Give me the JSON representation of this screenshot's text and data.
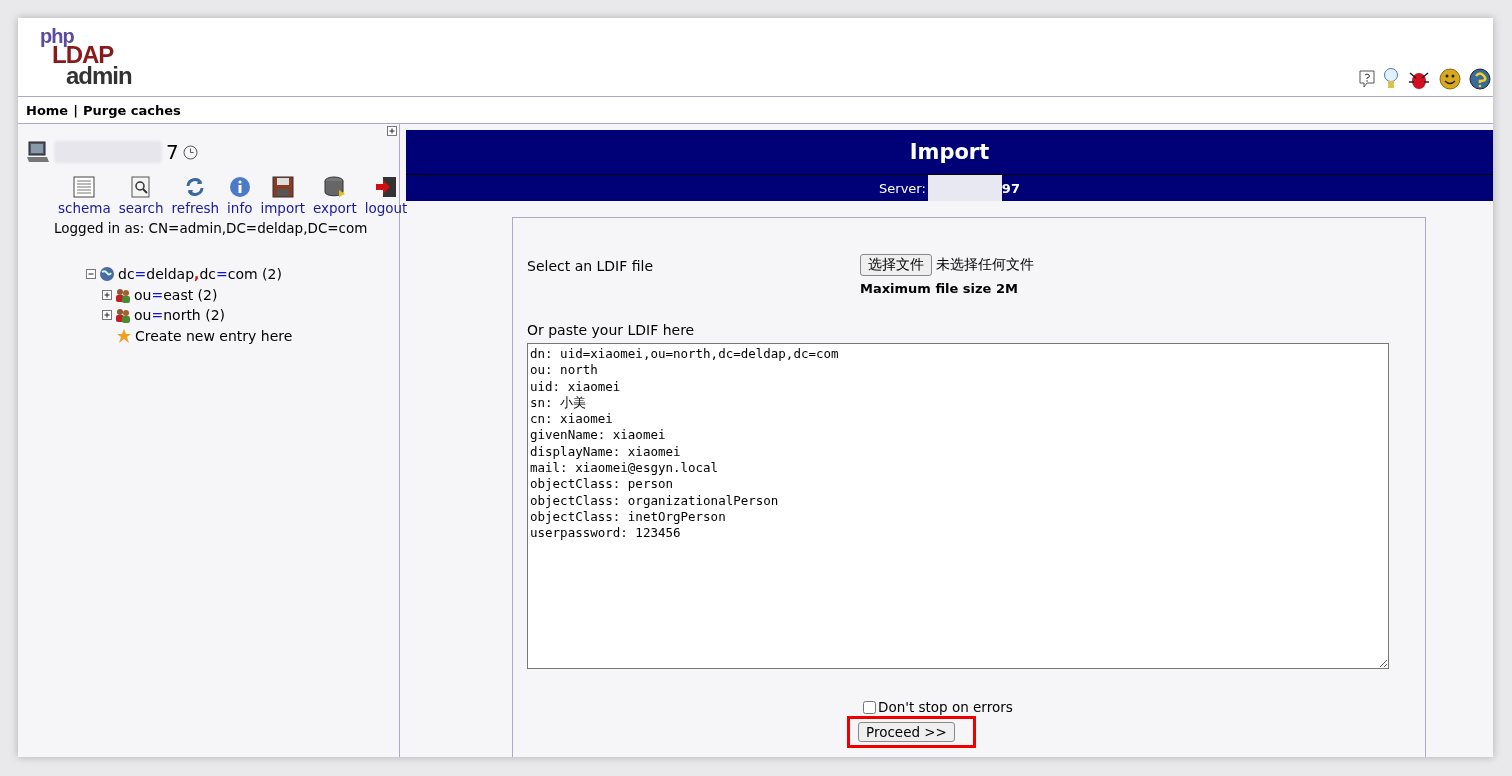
{
  "logo": {
    "parts": [
      "php",
      "LDAP",
      "admin"
    ]
  },
  "nav": {
    "links": [
      "Home",
      "Purge caches"
    ],
    "separator": "|"
  },
  "sidebar": {
    "server_name": "7",
    "toolbar": [
      {
        "label": "schema"
      },
      {
        "label": "search"
      },
      {
        "label": "refresh"
      },
      {
        "label": "info"
      },
      {
        "label": "import"
      },
      {
        "label": "export"
      },
      {
        "label": "logout"
      }
    ],
    "logged_in": "Logged in as: CN=admin,DC=deldap,DC=com",
    "tree": [
      {
        "kind": "base",
        "label": "dc=deldap,dc=com (2)",
        "expanded": true,
        "children": [
          {
            "kind": "ou",
            "label": "ou=east (2)",
            "expanded": false
          },
          {
            "kind": "ou",
            "label": "ou=north (2)",
            "expanded": false
          },
          {
            "kind": "create",
            "label": "Create new entry here"
          }
        ]
      }
    ]
  },
  "main": {
    "title": "Import",
    "server_label": "Server:",
    "server_name": "97",
    "file_label": "Select an LDIF file",
    "file_button": "选择文件",
    "file_status": "未选择任何文件",
    "max_size": "Maximum file size 2M",
    "paste_label": "Or paste your LDIF here",
    "ldif": "dn: uid=xiaomei,ou=north,dc=deldap,dc=com\nou: north\nuid: xiaomei\nsn: 小美\ncn: xiaomei\ngivenName: xiaomei\ndisplayName: xiaomei\nmail: xiaomei@esgyn.local\nobjectClass: person\nobjectClass: organizationalPerson\nobjectClass: inetOrgPerson\nuserpassword: 123456",
    "dont_stop": {
      "label": "Don't stop on errors",
      "checked": false
    },
    "proceed": {
      "label": "Proceed >>",
      "highlighted": true
    }
  }
}
